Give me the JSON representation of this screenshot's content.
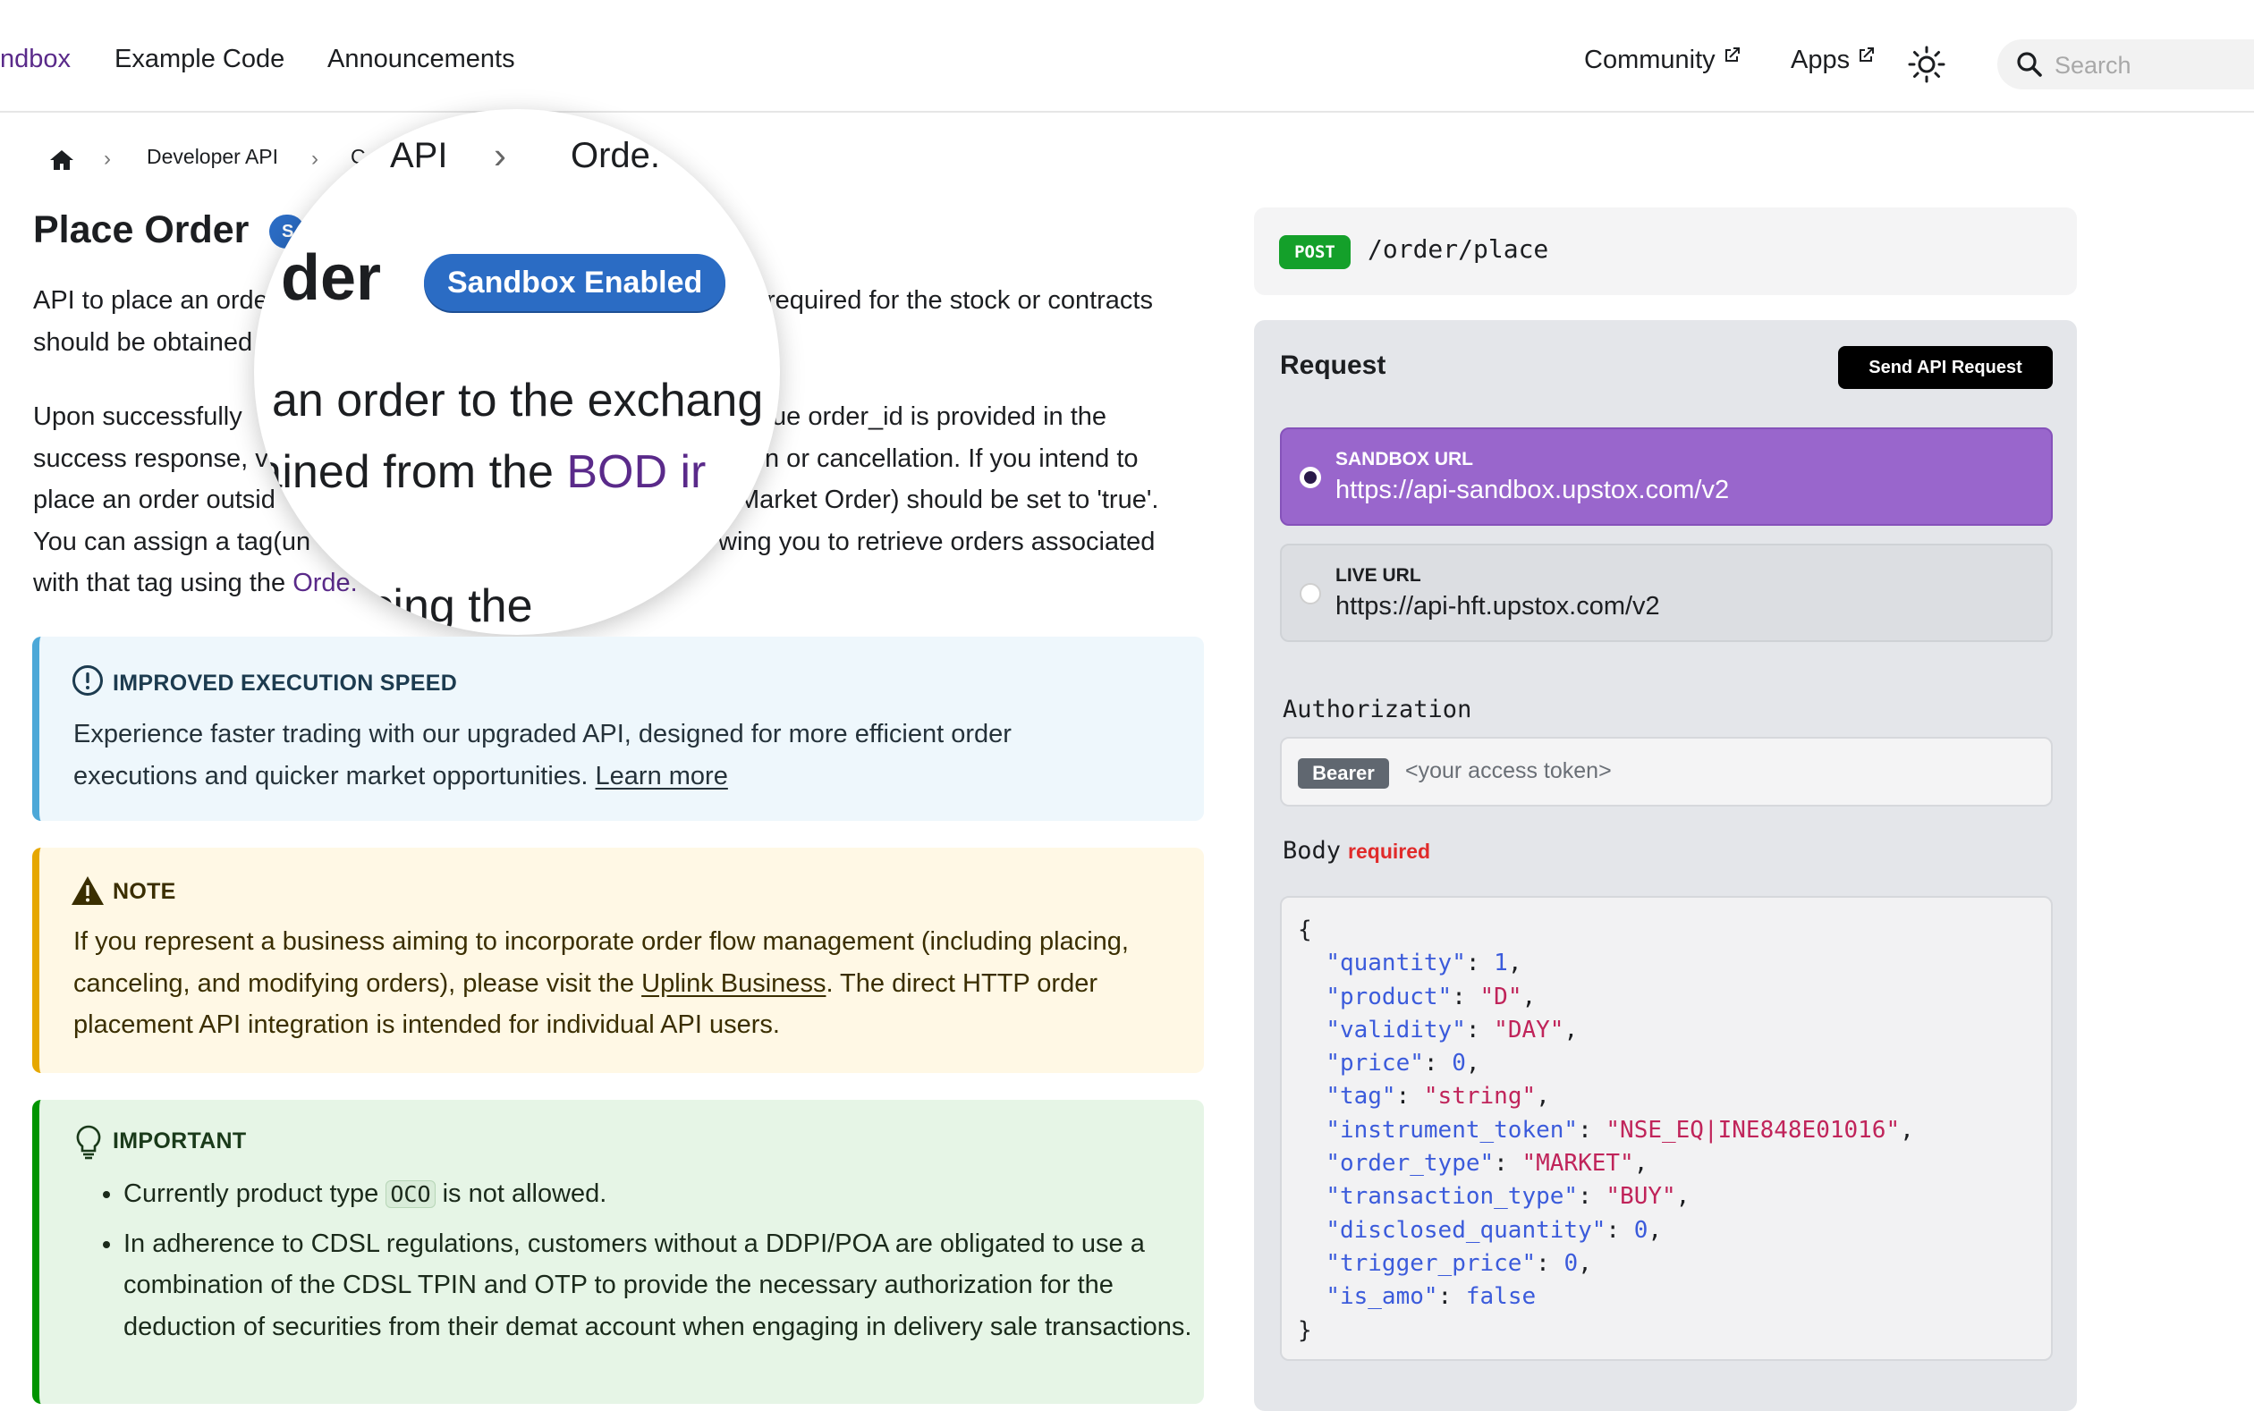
{
  "nav": {
    "brand": "ndbox",
    "links": [
      "Example Code",
      "Announcements"
    ],
    "community": "Community",
    "apps": "Apps",
    "search_placeholder": "Search",
    "kbd": "⌘"
  },
  "breadcrumb": {
    "item1": "Developer API",
    "item2": "C",
    "sep": "›"
  },
  "page": {
    "title": "Place Order",
    "badge_short": "S",
    "p1_a": "API to place an orde",
    "p1_b": "required for the stock or contracts",
    "p1_c": "should be obtained",
    "p2_lines": [
      [
        "Upon successfully ",
        "ue order_id is provided in the"
      ],
      [
        "success response, v",
        "n or cancellation. If you intend to"
      ],
      [
        "place an order outsid",
        "Market Order) should be set to 'true'."
      ],
      [
        "You can assign a tag(un",
        "wing you to retrieve orders associated"
      ]
    ],
    "p2_last_a": "with that tag using the ",
    "p2_last_link": "Orde."
  },
  "magnifier": {
    "crumb_api": "API",
    "crumb_sep": "›",
    "crumb_order": "Orde.",
    "crumb_c": "C",
    "title_frag": "der",
    "badge": "Sandbox Enabled",
    "line1": "an order to the exchang",
    "line2_a": "tained from the ",
    "line2_b": "BOD ir",
    "line3": "placing the"
  },
  "admonitions": {
    "info": {
      "title": "IMPROVED EXECUTION SPEED",
      "line1": "Experience faster trading with our upgraded API, designed for more efficient order",
      "line2": "executions and quicker market opportunities. ",
      "link": "Learn more"
    },
    "note": {
      "title": "NOTE",
      "line1": "If you represent a business aiming to incorporate order flow management (including placing,",
      "line2_a": "canceling, and modifying orders), please visit the ",
      "line2_link": "Uplink Business",
      "line2_b": ". The direct HTTP order",
      "line3": "placement API integration is intended for individual API users."
    },
    "important": {
      "title": "IMPORTANT",
      "b1_a": "Currently product type ",
      "b1_code": "OCO",
      "b1_b": " is not allowed.",
      "b2": "In adherence to CDSL regulations, customers without a DDPI/POA are obligated to use a combination of the CDSL TPIN and OTP to provide the necessary authorization for the deduction of securities from their demat account when engaging in delivery sale transactions."
    }
  },
  "endpoint": {
    "method": "POST",
    "path": "/order/place"
  },
  "request": {
    "title": "Request",
    "send_label": "Send API Request",
    "sandbox_label": "SANDBOX URL",
    "sandbox_url": "https://api-sandbox.upstox.com/v2",
    "live_label": "LIVE URL",
    "live_url": "https://api-hft.upstox.com/v2",
    "auth_label": "Authorization",
    "bearer": "Bearer",
    "token_placeholder": "<your access token>",
    "body_label": "Body",
    "required": "required",
    "body_fields": [
      {
        "key": "\"quantity\"",
        "val": "1",
        "type": "num"
      },
      {
        "key": "\"product\"",
        "val": "\"D\"",
        "type": "str"
      },
      {
        "key": "\"validity\"",
        "val": "\"DAY\"",
        "type": "str"
      },
      {
        "key": "\"price\"",
        "val": "0",
        "type": "num"
      },
      {
        "key": "\"tag\"",
        "val": "\"string\"",
        "type": "str"
      },
      {
        "key": "\"instrument_token\"",
        "val": "\"NSE_EQ|INE848E01016\"",
        "type": "str"
      },
      {
        "key": "\"order_type\"",
        "val": "\"MARKET\"",
        "type": "str"
      },
      {
        "key": "\"transaction_type\"",
        "val": "\"BUY\"",
        "type": "str"
      },
      {
        "key": "\"disclosed_quantity\"",
        "val": "0",
        "type": "num"
      },
      {
        "key": "\"trigger_price\"",
        "val": "0",
        "type": "num"
      },
      {
        "key": "\"is_amo\"",
        "val": "false",
        "type": "num"
      }
    ]
  },
  "colors": {
    "brand": "#5a2a8a",
    "post": "#14a02a",
    "sandbox": "#9966cc",
    "badge": "#2b6cc4",
    "required": "#e02a2a"
  }
}
